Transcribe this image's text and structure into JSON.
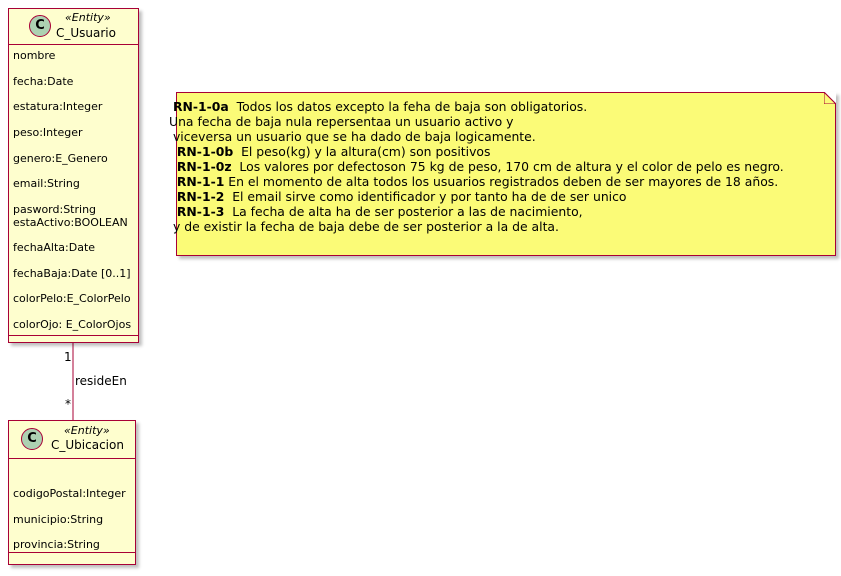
{
  "classes": {
    "usuario": {
      "stereotype": "«Entity»",
      "name": "C_Usuario",
      "icon": "C",
      "attributes": [
        "nombre",
        "fecha:Date",
        "estatura:Integer",
        "peso:Integer",
        "genero:E_Genero",
        "email:String",
        "pasword:String",
        "estaActivo:BOOLEAN",
        "fechaAlta:Date",
        "fechaBaja:Date [0..1]",
        "colorPelo:E_ColorPelo",
        "colorOjo: E_ColorOjos"
      ]
    },
    "ubicacion": {
      "stereotype": "«Entity»",
      "name": "C_Ubicacion",
      "icon": "C",
      "attributes": [
        "codigoPostal:Integer",
        "municipio:String",
        "provincia:String"
      ]
    }
  },
  "association": {
    "label": "resideEn",
    "source_multiplicity": "1",
    "target_multiplicity": "*"
  },
  "note": {
    "lines": [
      {
        "rule": "RN-1-0a",
        "text": "  Todos los datos excepto la feha de baja son obligatorios."
      },
      {
        "rule": "",
        "text": "Una fecha de baja nula repersentaa un usuario activo y"
      },
      {
        "rule": "",
        "text": " viceversa un usuario que se ha dado de baja logicamente."
      },
      {
        "rule": "RN-1-0b",
        "text": "  El peso(kg) y la altura(cm) son positivos"
      },
      {
        "rule": "RN-1-0z",
        "text": "  Los valores por defectoson 75 kg de peso, 170 cm de altura y el color de pelo es negro."
      },
      {
        "rule": "RN-1-1",
        "text": " En el momento de alta todos los usuarios registrados deben de ser mayores de 18 años."
      },
      {
        "rule": "RN-1-2",
        "text": "  El email sirve como identificador y por tanto ha de de ser unico"
      },
      {
        "rule": "RN-1-3",
        "text": "  La fecha de alta ha de ser posterior a las de nacimiento,"
      },
      {
        "rule": "",
        "text": " y de existir la fecha de baja debe de ser posterior a la de alta."
      }
    ]
  },
  "colors": {
    "class_fill": "#fefece",
    "border": "#a80036",
    "icon_fill": "#add1b2",
    "note_fill": "#fbfb77"
  }
}
